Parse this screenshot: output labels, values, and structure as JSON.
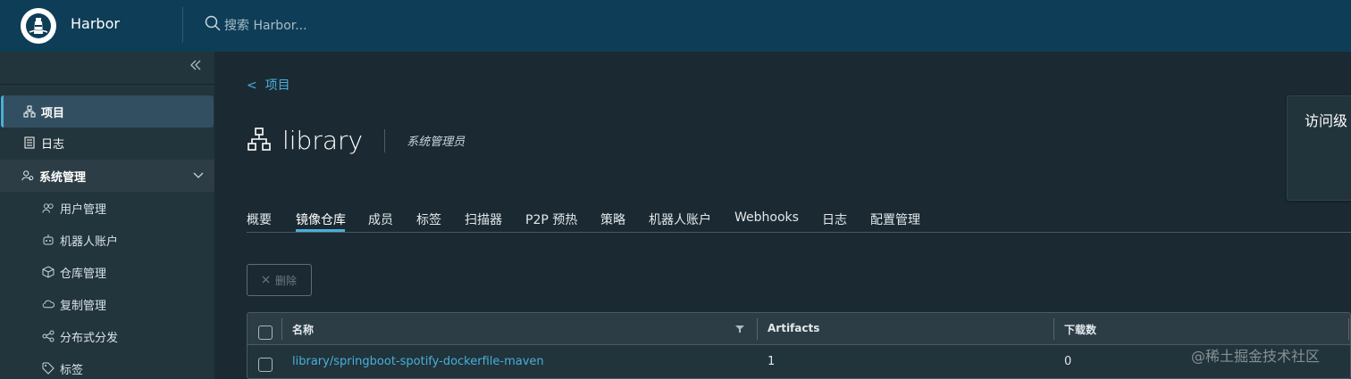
{
  "header": {
    "brand": "Harbor",
    "search_placeholder": "搜索 Harbor..."
  },
  "sidebar": {
    "items": [
      {
        "label": "项目"
      },
      {
        "label": "日志"
      },
      {
        "label": "系统管理"
      }
    ],
    "admin_items": [
      {
        "label": "用户管理"
      },
      {
        "label": "机器人账户"
      },
      {
        "label": "仓库管理"
      },
      {
        "label": "复制管理"
      },
      {
        "label": "分布式分发"
      },
      {
        "label": "标签"
      }
    ]
  },
  "main": {
    "breadcrumb": "项目",
    "project_name": "library",
    "role": "系统管理员",
    "tabs": [
      "概要",
      "镜像仓库",
      "成员",
      "标签",
      "扫描器",
      "P2P 预热",
      "策略",
      "机器人账户",
      "Webhooks",
      "日志",
      "配置管理"
    ],
    "active_tab": "镜像仓库",
    "delete_label": "删除",
    "info_card_label": "访问级"
  },
  "table": {
    "columns": [
      "名称",
      "Artifacts",
      "下载数"
    ],
    "rows": [
      {
        "name": "library/springboot-spotify-dockerfile-maven",
        "artifacts": "1",
        "downloads": "0"
      }
    ]
  },
  "watermark": "@稀土掘金技术社区",
  "colors": {
    "header_bg": "#0e3d57",
    "accent": "#49afd9",
    "sidebar_bg": "#22343c",
    "main_bg": "#1b2a32"
  }
}
